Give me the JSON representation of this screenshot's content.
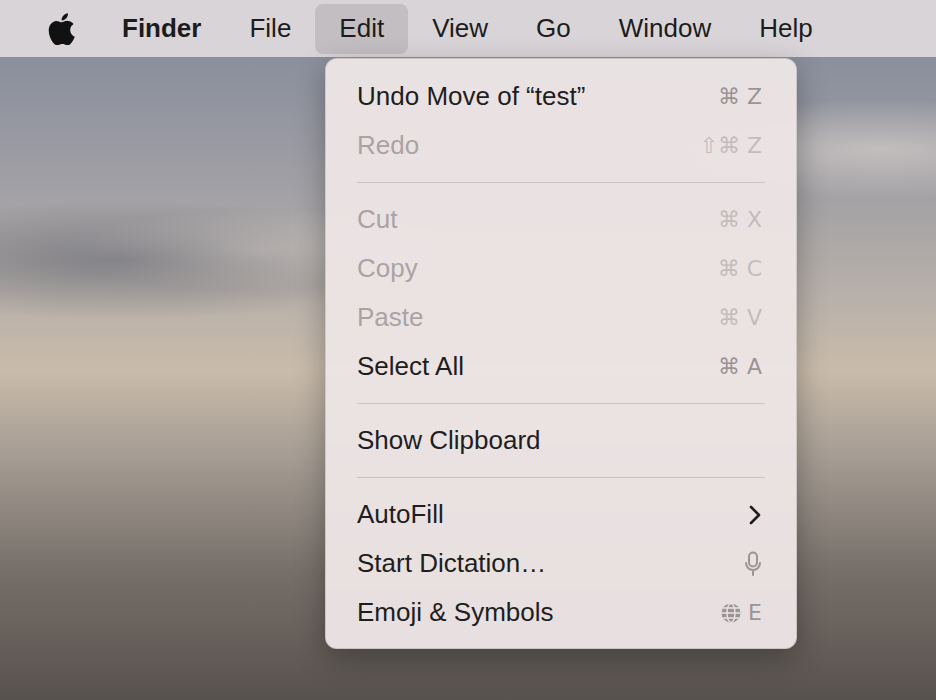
{
  "menu_bar": {
    "items": [
      {
        "label": "Finder",
        "kind": "app",
        "selected": false
      },
      {
        "label": "File",
        "kind": "menu",
        "selected": false
      },
      {
        "label": "Edit",
        "kind": "menu",
        "selected": true
      },
      {
        "label": "View",
        "kind": "menu",
        "selected": false
      },
      {
        "label": "Go",
        "kind": "menu",
        "selected": false
      },
      {
        "label": "Window",
        "kind": "menu",
        "selected": false
      },
      {
        "label": "Help",
        "kind": "menu",
        "selected": false
      }
    ]
  },
  "menu": {
    "groups": [
      [
        {
          "label": "Undo Move of “test”",
          "kind": "shortcut",
          "shortcut": "⌘ Z",
          "disabled": false
        },
        {
          "label": "Redo",
          "kind": "shortcut",
          "shortcut": "⇧⌘ Z",
          "disabled": true
        }
      ],
      [
        {
          "label": "Cut",
          "kind": "shortcut",
          "shortcut": "⌘ X",
          "disabled": true
        },
        {
          "label": "Copy",
          "kind": "shortcut",
          "shortcut": "⌘ C",
          "disabled": true
        },
        {
          "label": "Paste",
          "kind": "shortcut",
          "shortcut": "⌘ V",
          "disabled": true
        },
        {
          "label": "Select All",
          "kind": "shortcut",
          "shortcut": "⌘ A",
          "disabled": false
        }
      ],
      [
        {
          "label": "Show Clipboard",
          "kind": "plain",
          "disabled": false
        }
      ],
      [
        {
          "label": "AutoFill",
          "kind": "submenu",
          "disabled": false
        },
        {
          "label": "Start Dictation…",
          "kind": "mic",
          "disabled": false
        },
        {
          "label": "Emoji & Symbols",
          "kind": "globe",
          "shortcut": "E",
          "disabled": false
        }
      ]
    ]
  }
}
